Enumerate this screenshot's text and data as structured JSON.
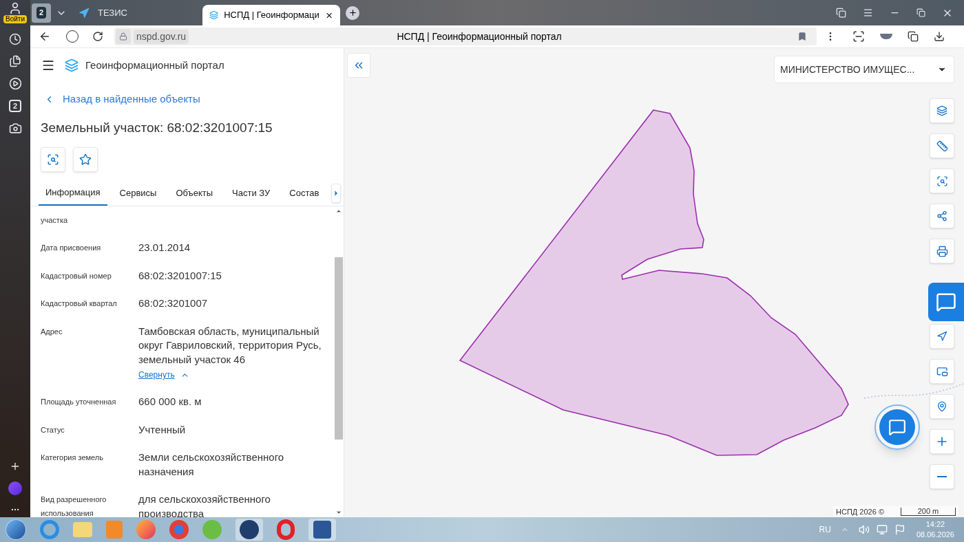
{
  "browser": {
    "login_badge": "Войти",
    "tab_count": "2",
    "tabs": [
      {
        "title": "ТЕЗИС",
        "selected": false
      },
      {
        "title": "НСПД | Геоинформаци",
        "selected": true
      }
    ],
    "url": "nspd.gov.ru",
    "page_title": "НСПД | Геоинформационный портал"
  },
  "side_rail": {
    "counter": "2"
  },
  "panel": {
    "app_title": "Геоинформационный портал",
    "back_link": "Назад в найденные объекты",
    "heading": "Земельный участок: 68:02:3201007:15",
    "tabs": [
      {
        "label": "Информация",
        "selected": true
      },
      {
        "label": "Сервисы",
        "selected": false
      },
      {
        "label": "Объекты",
        "selected": false
      },
      {
        "label": "Части ЗУ",
        "selected": false
      },
      {
        "label": "Состав",
        "selected": false
      }
    ],
    "fields": [
      {
        "label": "участка"
      },
      {
        "label": "Дата присвоения",
        "value": "23.01.2014"
      },
      {
        "label": "Кадастровый номер",
        "value": "68:02:3201007:15"
      },
      {
        "label": "Кадастровый квартал",
        "value": "68:02:3201007"
      },
      {
        "label": "Адрес",
        "value": "Тамбовская область, муниципальный округ Гавриловский, территория Русь, земельный участок 46",
        "link": "Свернуть"
      },
      {
        "label": "Площадь уточненная",
        "value": "660 000 кв. м"
      },
      {
        "label": "Статус",
        "value": "Учтенный"
      },
      {
        "label": "Категория земель",
        "value": "Земли сельскохозяйственного назначения"
      },
      {
        "label": "Вид разрешенного использования",
        "value": "для сельскохозяйственного производства"
      }
    ]
  },
  "map": {
    "dropdown": "МИНИСТЕРСТВО ИМУЩЕС...",
    "copyright": "НСПД 2026 ©",
    "scale": "200 m"
  },
  "taskbar": {
    "language": "RU",
    "time": "14:22",
    "date": "08.06.2026"
  }
}
